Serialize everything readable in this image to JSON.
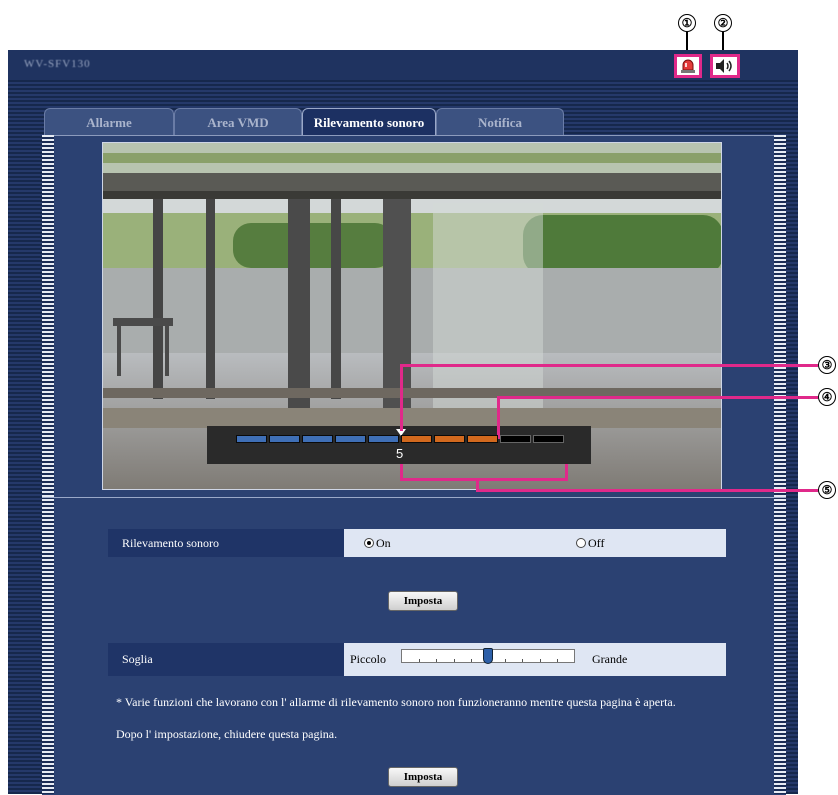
{
  "header": {
    "camera_title": "WV-SFV130"
  },
  "top_buttons": {
    "alarm_icon": "alarm-icon",
    "audio_icon": "speaker-icon",
    "callout_1": "①",
    "callout_2": "②"
  },
  "tabs": [
    {
      "label": "Allarme",
      "active": false
    },
    {
      "label": "Area VMD",
      "active": false
    },
    {
      "label": "Rilevamento sonoro",
      "active": true
    },
    {
      "label": "Notifica",
      "active": false
    }
  ],
  "meter": {
    "level_label": "5",
    "segments": [
      "blue",
      "blue",
      "blue",
      "blue",
      "blue",
      "orange",
      "orange",
      "orange",
      "black",
      "black"
    ],
    "colors": {
      "blue": "#3f6fb6",
      "orange": "#d2691e",
      "black": "#000000"
    }
  },
  "callouts": {
    "c3": "③",
    "c4": "④",
    "c5": "⑤"
  },
  "audio_detection": {
    "label": "Rilevamento sonoro",
    "on_label": "On",
    "off_label": "Off",
    "selected": "On"
  },
  "set_button_label": "Imposta",
  "threshold": {
    "label": "Soglia",
    "min_label": "Piccolo",
    "max_label": "Grande",
    "value_fraction": 0.5
  },
  "note": {
    "line1": "* Varie funzioni che lavorano con l' allarme di rilevamento sonoro non funzioneranno mentre questa pagina è aperta.",
    "line2": "Dopo l' impostazione, chiudere questa pagina."
  },
  "colors": {
    "callout_pink": "#e0298a",
    "panel_blue": "#2b4172"
  }
}
